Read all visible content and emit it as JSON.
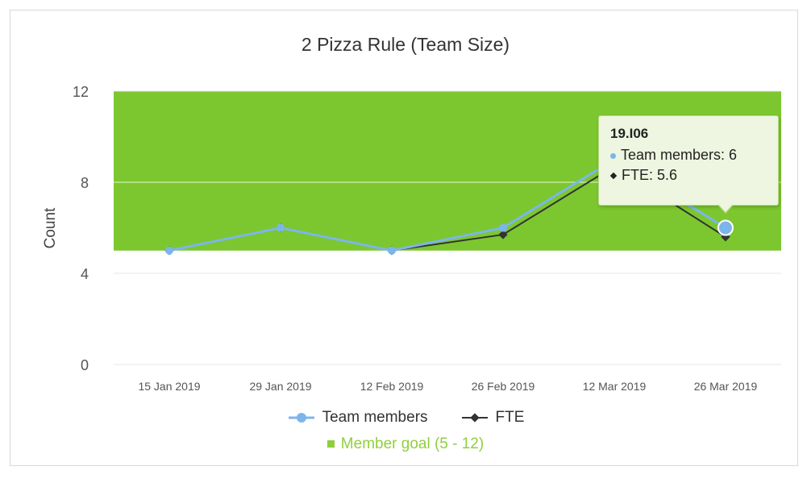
{
  "chart_data": {
    "type": "line",
    "title": "2 Pizza Rule (Team Size)",
    "ylabel": "Count",
    "xlabel": "",
    "ylim": [
      0,
      12
    ],
    "yticks": [
      "0",
      "4",
      "8",
      "12"
    ],
    "categories": [
      "15 Jan 2019",
      "29 Jan 2019",
      "12 Feb 2019",
      "26 Feb 2019",
      "12 Mar 2019",
      "26 Mar 2019"
    ],
    "series": [
      {
        "name": "Team members",
        "values": [
          5,
          6,
          5,
          6,
          9,
          6
        ],
        "color": "#7cb5ec"
      },
      {
        "name": "FTE",
        "values": [
          5,
          6,
          5,
          5.7,
          8.7,
          5.6
        ],
        "color": "#333333"
      }
    ],
    "band": {
      "name": "Member goal (5 - 12)",
      "from": 5,
      "to": 12,
      "color": "#7cc72f"
    },
    "grid": true,
    "legend": "bottom"
  },
  "tooltip": {
    "title": "19.I06",
    "row1": "Team members: 6",
    "row2": "FTE: 5.6"
  },
  "legend": {
    "team_members": "Team members",
    "fte": "FTE",
    "goal": "Member goal (5 - 12)"
  },
  "colors": {
    "goal_text": "#8fcf3c",
    "team": "#7cb5ec",
    "fte": "#333333"
  }
}
